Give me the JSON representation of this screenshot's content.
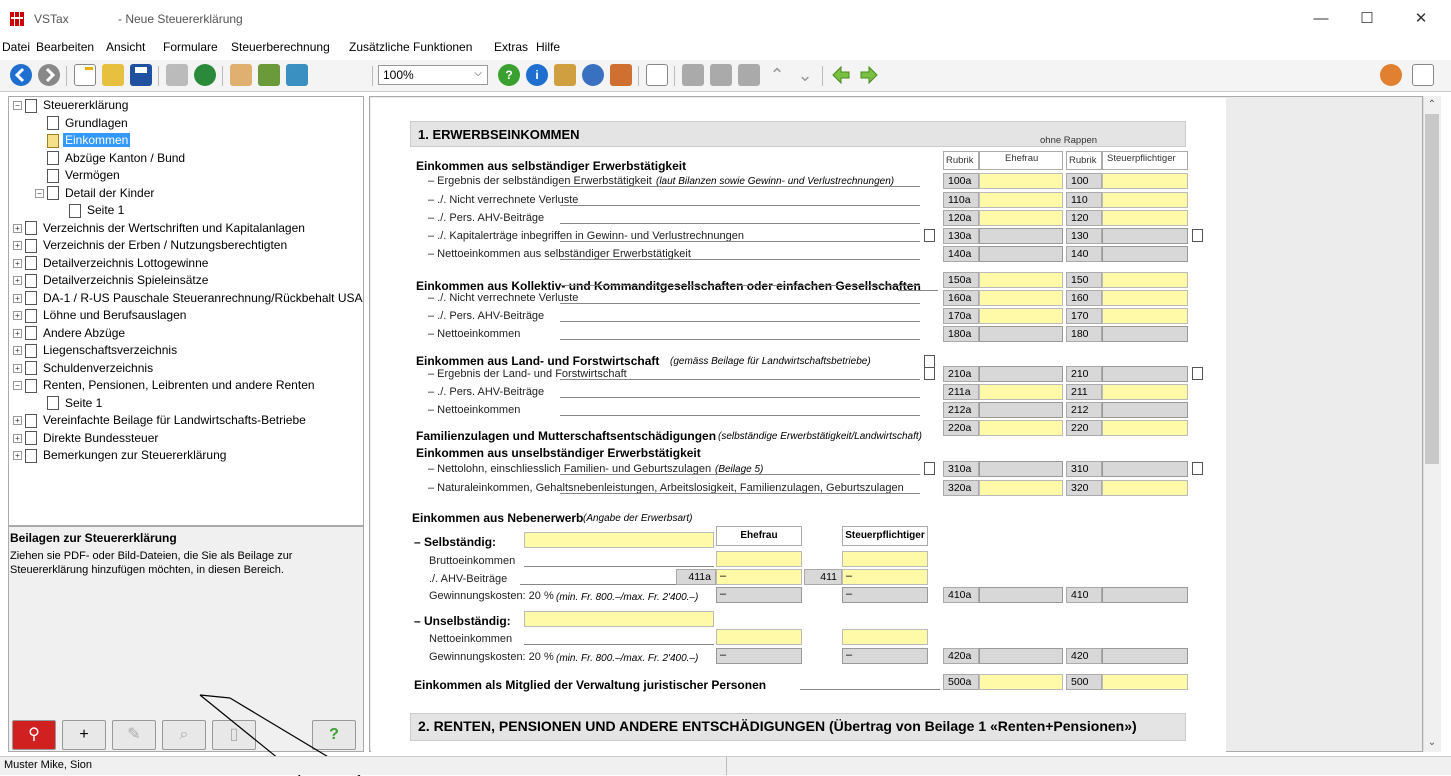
{
  "window": {
    "app_name": "VSTax",
    "doc_title": "- Neue Steuererklärung",
    "minimize": "—",
    "maximize": "☐",
    "close": "✕"
  },
  "menu": [
    "Datei",
    "Bearbeiten",
    "Ansicht",
    "Formulare",
    "Steuerberechnung",
    "Zusätzliche Funktionen",
    "Extras",
    "Hilfe"
  ],
  "toolbar": {
    "zoom": "100%",
    "icons": [
      "back-icon",
      "forward-icon",
      "new-icon",
      "open-icon",
      "save-icon",
      "print-icon",
      "globe-icon",
      "users-icon",
      "edit-doc-icon",
      "home-icon",
      "help-icon",
      "info-icon",
      "pen-icon",
      "web-icon",
      "person-card-icon",
      "page-icon",
      "row-insert-icon",
      "row-delete-icon",
      "grid-icon",
      "up-icon",
      "down-icon",
      "arrow-left-icon",
      "arrow-right-icon",
      "user-icon",
      "notepad-icon"
    ]
  },
  "tree": [
    {
      "label": "Steuererklärung",
      "level": 0,
      "exp": "−",
      "doc": true
    },
    {
      "label": "Grundlagen",
      "level": 1,
      "doc": true
    },
    {
      "label": "Einkommen",
      "level": 1,
      "doc": true,
      "selected": true,
      "yellow": true
    },
    {
      "label": "Abzüge Kanton / Bund",
      "level": 1,
      "doc": true
    },
    {
      "label": "Vermögen",
      "level": 1,
      "doc": true
    },
    {
      "label": "Detail der Kinder",
      "level": 1,
      "exp": "−",
      "doc": true
    },
    {
      "label": "Seite 1",
      "level": 2,
      "doc": true
    },
    {
      "label": "Verzeichnis der Wertschriften und Kapitalanlagen",
      "level": 0,
      "exp": "+",
      "doc": true
    },
    {
      "label": "Verzeichnis der Erben / Nutzungsberechtigten",
      "level": 0,
      "exp": "+",
      "doc": true
    },
    {
      "label": "Detailverzeichnis Lottogewinne",
      "level": 0,
      "exp": "+",
      "doc": true
    },
    {
      "label": "Detailverzeichnis Spieleinsätze",
      "level": 0,
      "exp": "+",
      "doc": true
    },
    {
      "label": "DA-1 / R-US Pauschale Steueranrechnung/Rückbehalt USA",
      "level": 0,
      "exp": "+",
      "doc": true
    },
    {
      "label": "Löhne und Berufsauslagen",
      "level": 0,
      "exp": "+",
      "doc": true
    },
    {
      "label": "Andere Abzüge",
      "level": 0,
      "exp": "+",
      "doc": true
    },
    {
      "label": "Liegenschaftsverzeichnis",
      "level": 0,
      "exp": "+",
      "doc": true
    },
    {
      "label": "Schuldenverzeichnis",
      "level": 0,
      "exp": "+",
      "doc": true
    },
    {
      "label": "Renten, Pensionen, Leibrenten und andere Renten",
      "level": 0,
      "exp": "−",
      "doc": true
    },
    {
      "label": "Seite 1",
      "level": 1,
      "doc": true
    },
    {
      "label": "Vereinfachte Beilage für Landwirtschafts-Betriebe",
      "level": 0,
      "exp": "+",
      "doc": true
    },
    {
      "label": "Direkte Bundessteuer",
      "level": 0,
      "exp": "+",
      "doc": true
    },
    {
      "label": "Bemerkungen zur Steuererklärung",
      "level": 0,
      "exp": "+",
      "doc": true
    }
  ],
  "beilagen": {
    "title": "Beilagen zur Steuererklärung",
    "text": "Ziehen sie PDF- oder Bild-Dateien, die Sie als Beilage zur Steuererklärung hinzufügen möchten, in diesen Bereich."
  },
  "status": {
    "user": "Muster Mike, Sion"
  },
  "form": {
    "section1": "1. ERWERBSEINKOMMEN",
    "ohne_rappen": "ohne Rappen",
    "col_rubrik": "Rubrik",
    "col_ehefrau": "Ehefrau",
    "col_stpfl": "Steuerpflichtiger",
    "g1_title": "Einkommen aus selbständiger Erwerbstätigkeit",
    "g1_rows": [
      {
        "label": "– Ergebnis der selbständigen Erwerbstätigkeit",
        "note": "(laut Bilanzen sowie Gewinn- und Verlustrechnungen)",
        "a": "100a",
        "b": "100",
        "ya": true,
        "yb": true
      },
      {
        "label": "– ./. Nicht verrechnete Verluste",
        "a": "110a",
        "b": "110",
        "ya": true,
        "yb": true
      },
      {
        "label": "– ./. Pers. AHV-Beiträge",
        "a": "120a",
        "b": "120",
        "ya": true,
        "yb": true
      },
      {
        "label": "– ./. Kapitalerträge inbegriffen in Gewinn- und Verlustrechnungen",
        "a": "130a",
        "b": "130",
        "ya": false,
        "yb": false,
        "icon": true
      },
      {
        "label": "– Nettoeinkommen aus selbständiger Erwerbstätigkeit",
        "a": "140a",
        "b": "140",
        "ya": false,
        "yb": false
      }
    ],
    "g2_title": "Einkommen aus Kollektiv- und Kommanditgesellschaften oder einfachen Gesellschaften",
    "g2_rows": [
      {
        "label": "",
        "a": "150a",
        "b": "150",
        "ya": true,
        "yb": true
      },
      {
        "label": "– ./. Nicht verrechnete Verluste",
        "a": "160a",
        "b": "160",
        "ya": true,
        "yb": true
      },
      {
        "label": "– ./. Pers. AHV-Beiträge",
        "a": "170a",
        "b": "170",
        "ya": true,
        "yb": true
      },
      {
        "label": "– Nettoeinkommen",
        "a": "180a",
        "b": "180",
        "ya": false,
        "yb": false
      }
    ],
    "g3_title": "Einkommen aus Land- und Forstwirtschaft",
    "g3_note": "(gemäss Beilage für Landwirtschaftsbetriebe)",
    "g3_rows": [
      {
        "label": "– Ergebnis der Land- und Forstwirtschaft",
        "a": "210a",
        "b": "210",
        "ya": false,
        "yb": false,
        "icon": true
      },
      {
        "label": "– ./. Pers. AHV-Beiträge",
        "a": "211a",
        "b": "211",
        "ya": true,
        "yb": true
      },
      {
        "label": "– Nettoeinkommen",
        "a": "212a",
        "b": "212",
        "ya": false,
        "yb": false
      }
    ],
    "g4_title": "Familienzulagen und Mutterschaftsentschädigungen",
    "g4_note": "(selbständige Erwerbstätigkeit/Landwirtschaft)",
    "g4_a": "220a",
    "g4_b": "220",
    "g5_title": "Einkommen aus unselbständiger Erwerbstätigkeit",
    "g5_rows": [
      {
        "label": "– Nettolohn, einschliesslich Familien- und Geburtszulagen",
        "note": "(Beilage 5)",
        "a": "310a",
        "b": "310",
        "ya": false,
        "yb": false,
        "icon": true
      },
      {
        "label": "– Naturaleinkommen, Gehaltsnebenleistungen, Arbeitslosigkeit, Familienzulagen, Geburtszulagen",
        "a": "320a",
        "b": "320",
        "ya": true,
        "yb": true
      }
    ],
    "g6_title": "Einkommen aus Nebenerwerb",
    "g6_note": "(Angabe der Erwerbsart)",
    "selb": "– Selbständig:",
    "unselb": "– Unselbständig:",
    "ehefrau": "Ehefrau",
    "stpfl": "Steuerpflichtiger",
    "brutto": "Bruttoeinkommen",
    "ahv": "./. AHV-Beiträge",
    "r411a": "411a",
    "r411": "411",
    "gewk1": "Gewinnungskosten: 20 %",
    "gewk_note": "(min. Fr. 800.–/max. Fr. 2'400.–)",
    "r410a": "410a",
    "r410": "410",
    "netto": "Nettoeinkommen",
    "r420a": "420a",
    "r420": "420",
    "g7_title": "Einkommen als Mitglied der Verwaltung juristischer Personen",
    "r500a": "500a",
    "r500": "500",
    "section2": "2. RENTEN, PENSIONEN UND ANDERE ENTSCHÄDIGUNGEN (Übertrag von Beilage 1 «Renten+Pensionen»)",
    "minus": "–"
  }
}
